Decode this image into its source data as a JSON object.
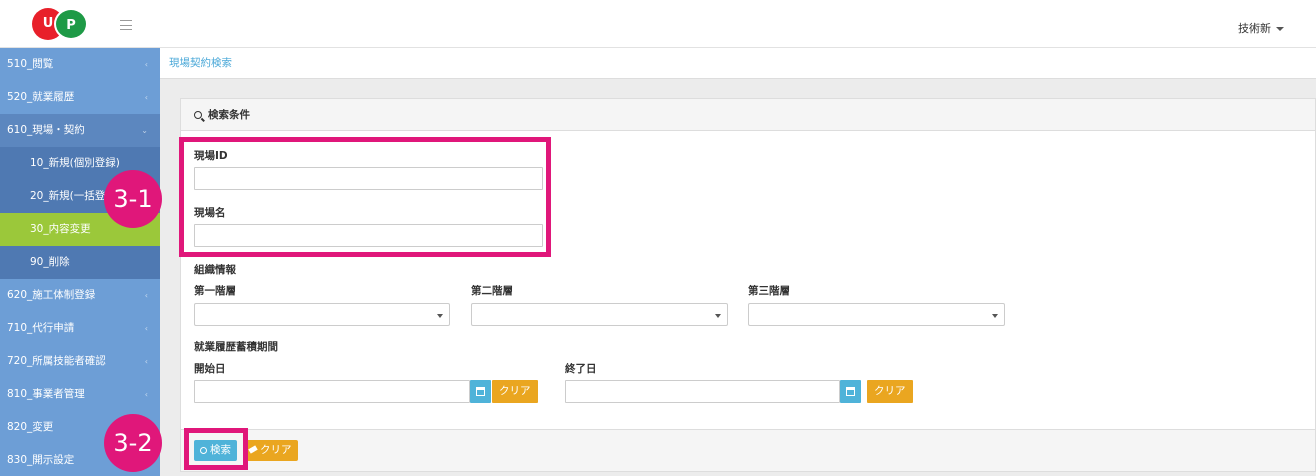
{
  "header": {
    "logo_text_left": "U",
    "logo_text_right": "P",
    "user_label": "技術新"
  },
  "sidebar": {
    "items": [
      {
        "label": "510_閲覧"
      },
      {
        "label": "520_就業履歴"
      },
      {
        "label": "610_現場・契約"
      },
      {
        "label": "10_新規(個別登録)"
      },
      {
        "label": "20_新規(一括登"
      },
      {
        "label": "30_内容変更"
      },
      {
        "label": "90_削除"
      },
      {
        "label": "620_施工体制登録"
      },
      {
        "label": "710_代行申請"
      },
      {
        "label": "720_所属技能者確認"
      },
      {
        "label": "810_事業者管理"
      },
      {
        "label": "820_変更"
      },
      {
        "label": "830_開示設定"
      }
    ]
  },
  "breadcrumb": "現場契約検索",
  "panel": {
    "title": "検索条件",
    "site_id_label": "現場ID",
    "site_name_label": "現場名",
    "org_info_label": "組織情報",
    "level1_label": "第一階層",
    "level2_label": "第二階層",
    "level3_label": "第三階層",
    "period_label": "就業履歴蓄積期間",
    "start_label": "開始日",
    "end_label": "終了日",
    "clear_label": "クリア",
    "search_button": "検索",
    "clear_button": "クリア"
  },
  "annotations": {
    "badge1": "3-1",
    "badge2": "3-2"
  },
  "colors": {
    "sidebar": "#6d9ed6",
    "active": "#9bc83a",
    "accent": "#4fb3d9",
    "clear": "#eaa620",
    "annotation": "#e0177a"
  }
}
